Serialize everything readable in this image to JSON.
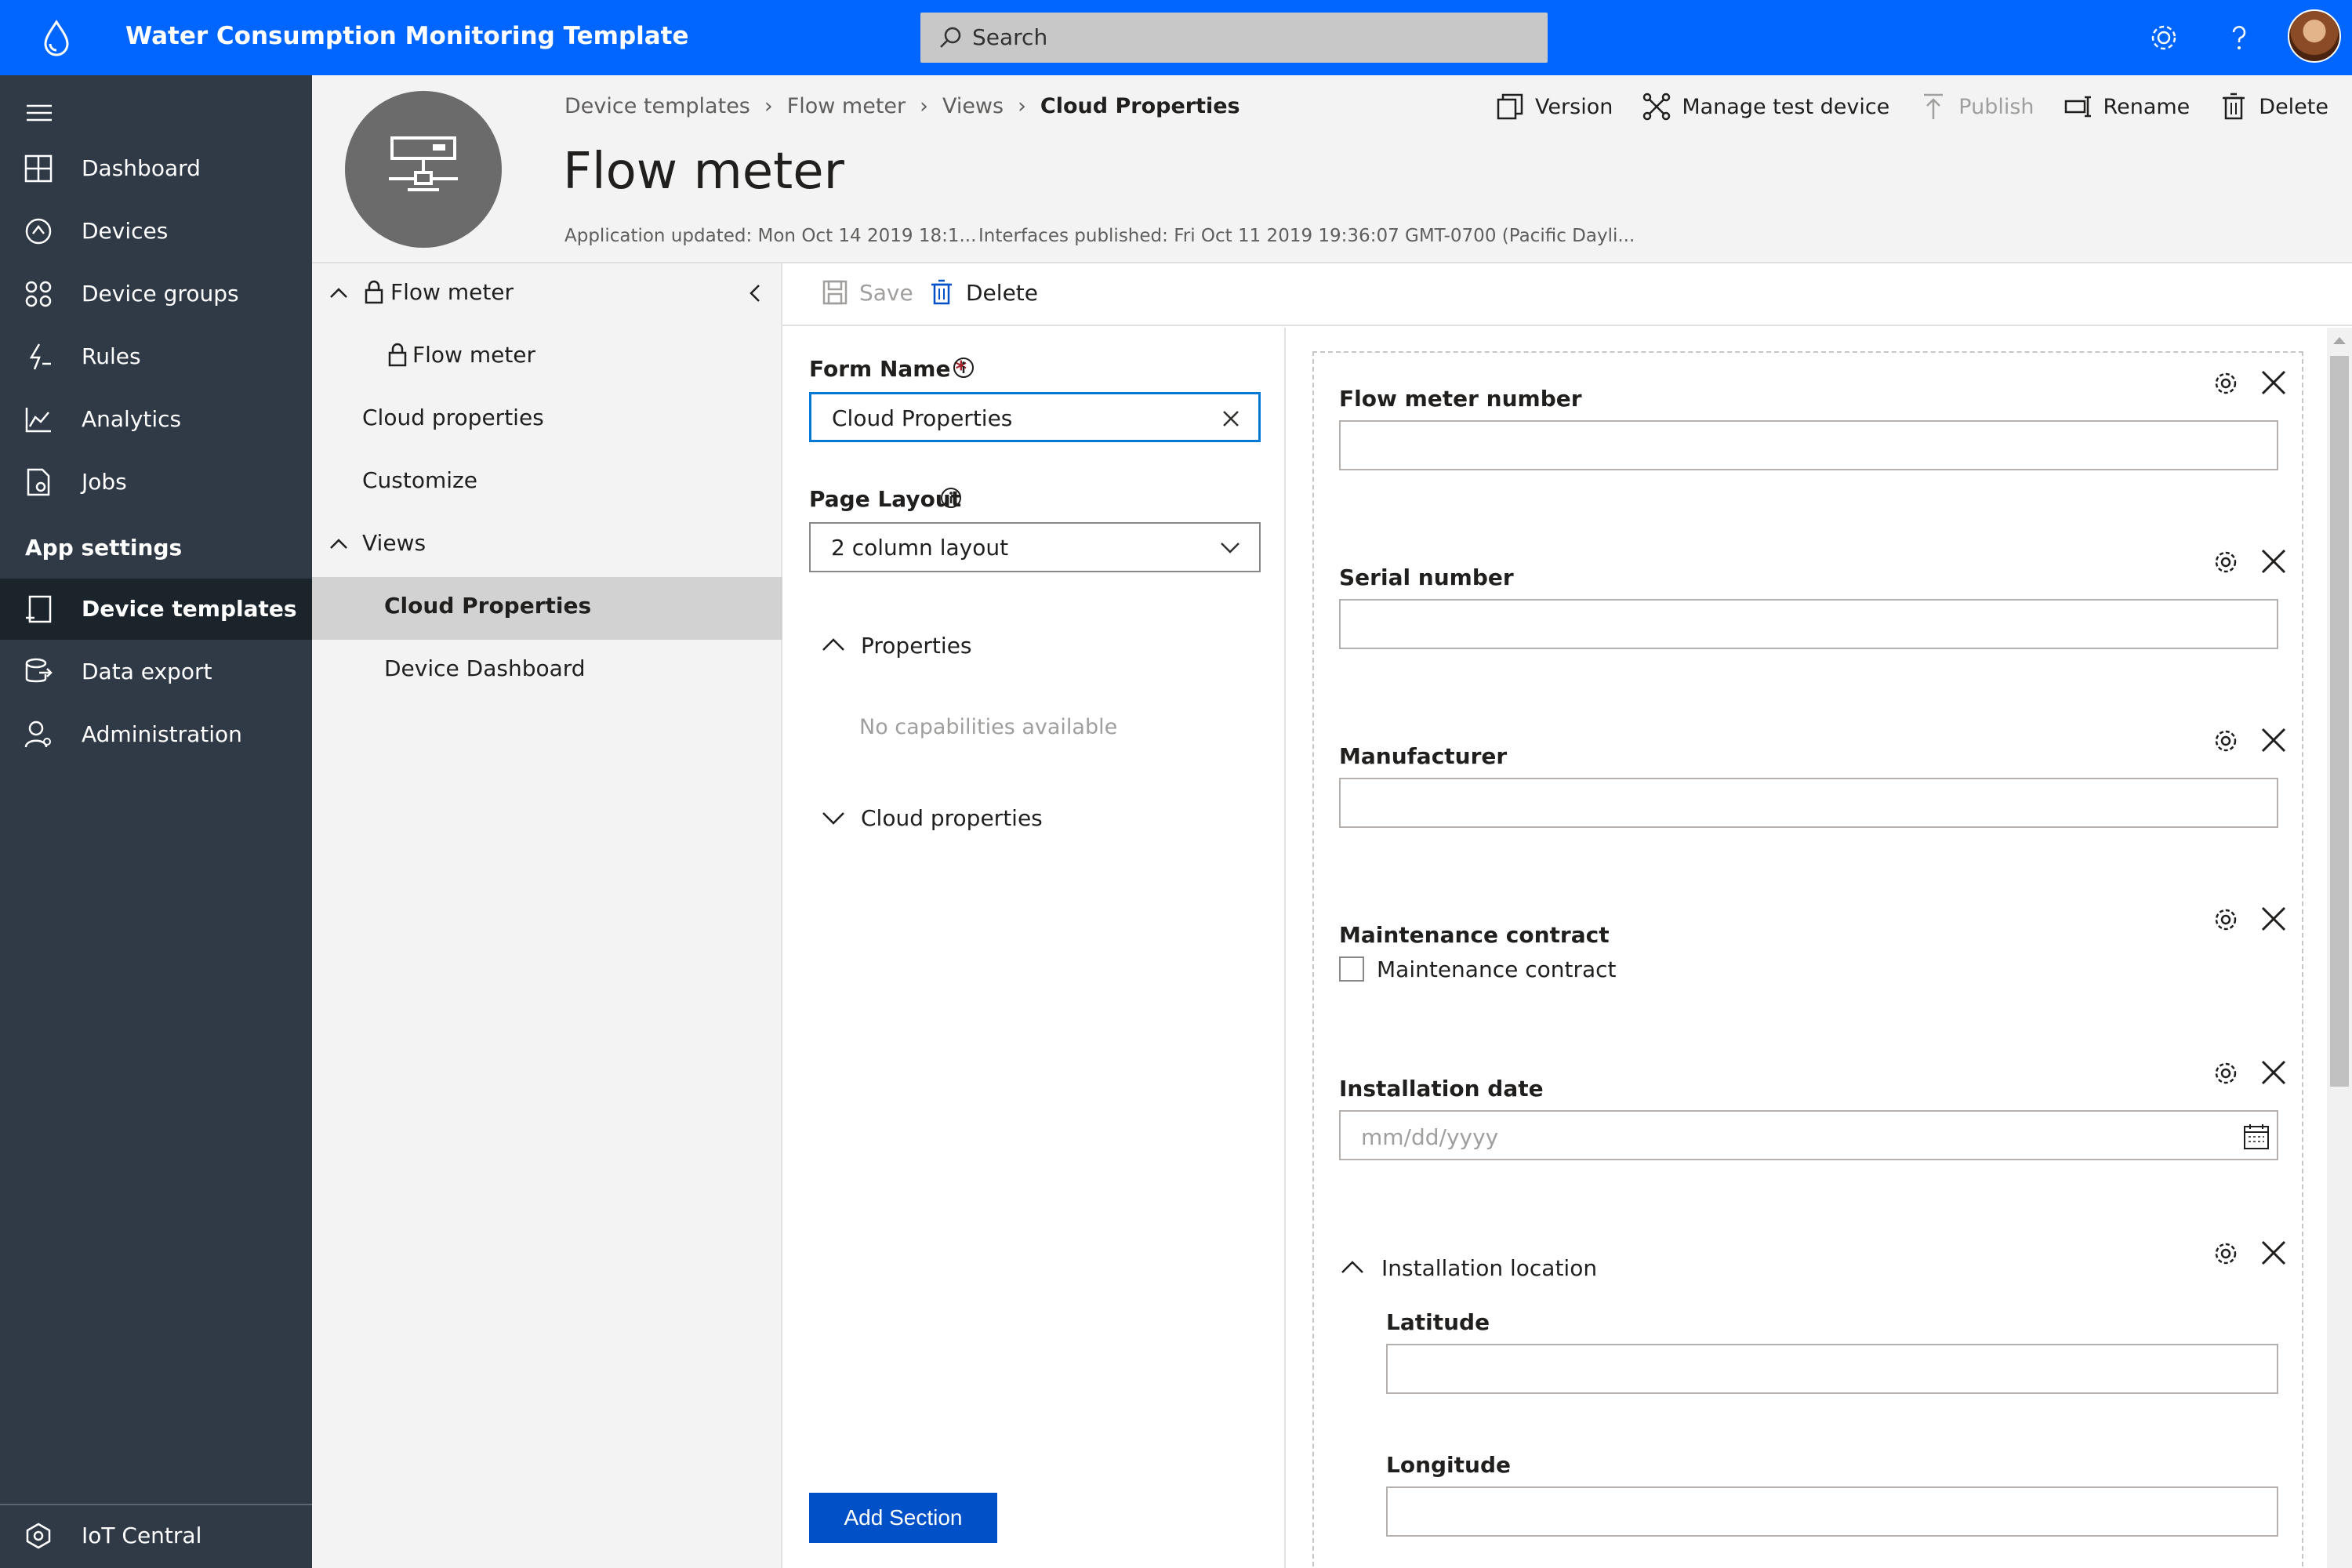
{
  "app": {
    "title": "Water Consumption Monitoring Template"
  },
  "search": {
    "placeholder": "Search"
  },
  "nav": {
    "items": [
      {
        "label": "Dashboard"
      },
      {
        "label": "Devices"
      },
      {
        "label": "Device groups"
      },
      {
        "label": "Rules"
      },
      {
        "label": "Analytics"
      },
      {
        "label": "Jobs"
      }
    ],
    "section_label": "App settings",
    "settings_items": [
      {
        "label": "Device templates"
      },
      {
        "label": "Data export"
      },
      {
        "label": "Administration"
      }
    ],
    "bottom_label": "IoT Central"
  },
  "breadcrumb": [
    "Device templates",
    "Flow meter",
    "Views",
    "Cloud Properties"
  ],
  "header": {
    "title": "Flow meter",
    "app_updated": "Application updated: Mon Oct 14 2019 18:1...",
    "interfaces_published": "Interfaces published: Fri Oct 11 2019 19:36:07 GMT-0700 (Pacific Dayli..."
  },
  "actions": {
    "version": "Version",
    "manage_test_device": "Manage test device",
    "publish": "Publish",
    "rename": "Rename",
    "delete": "Delete"
  },
  "tree": {
    "root": "Flow meter",
    "child": "Flow meter",
    "cloud_properties": "Cloud properties",
    "customize": "Customize",
    "views": "Views",
    "view_cloud_properties": "Cloud Properties",
    "view_device_dashboard": "Device Dashboard"
  },
  "toolbar": {
    "save": "Save",
    "delete": "Delete"
  },
  "form": {
    "form_name_label": "Form Name",
    "form_name_value": "Cloud Properties",
    "page_layout_label": "Page Layout",
    "page_layout_value": "2 column layout",
    "properties_label": "Properties",
    "no_capabilities": "No capabilities available",
    "cloud_properties_label": "Cloud properties",
    "add_section": "Add Section"
  },
  "canvas": {
    "flow_meter_number": "Flow meter number",
    "serial_number": "Serial number",
    "manufacturer": "Manufacturer",
    "maintenance_contract": "Maintenance contract",
    "maintenance_contract_checkbox": "Maintenance contract",
    "installation_date": "Installation date",
    "installation_date_placeholder": "mm/dd/yyyy",
    "installation_location": "Installation location",
    "latitude": "Latitude",
    "longitude": "Longitude"
  },
  "colors": {
    "topbar": "#0066ff",
    "leftnav": "#2f3a46",
    "accent": "#0050c8",
    "required": "#a4262c"
  }
}
